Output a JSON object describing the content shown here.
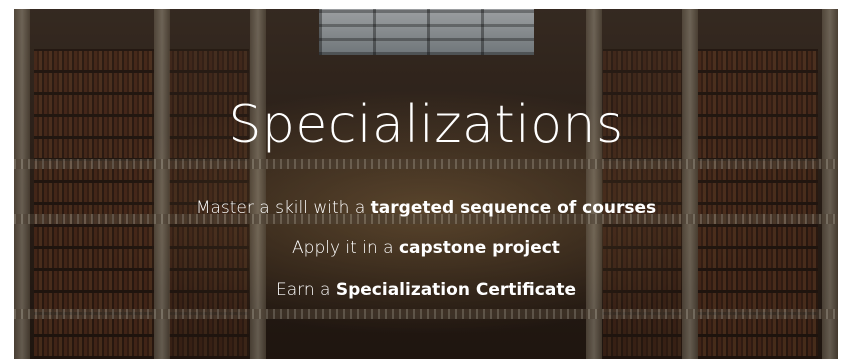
{
  "hero": {
    "title": "Specializations",
    "lines": [
      {
        "prefix": "Master a skill with a ",
        "emphasis": "targeted sequence of courses"
      },
      {
        "prefix": "Apply it in a ",
        "emphasis": "capstone project"
      },
      {
        "prefix": "Earn a ",
        "emphasis": "Specialization Certificate"
      }
    ],
    "text_color": "#ffffff"
  }
}
